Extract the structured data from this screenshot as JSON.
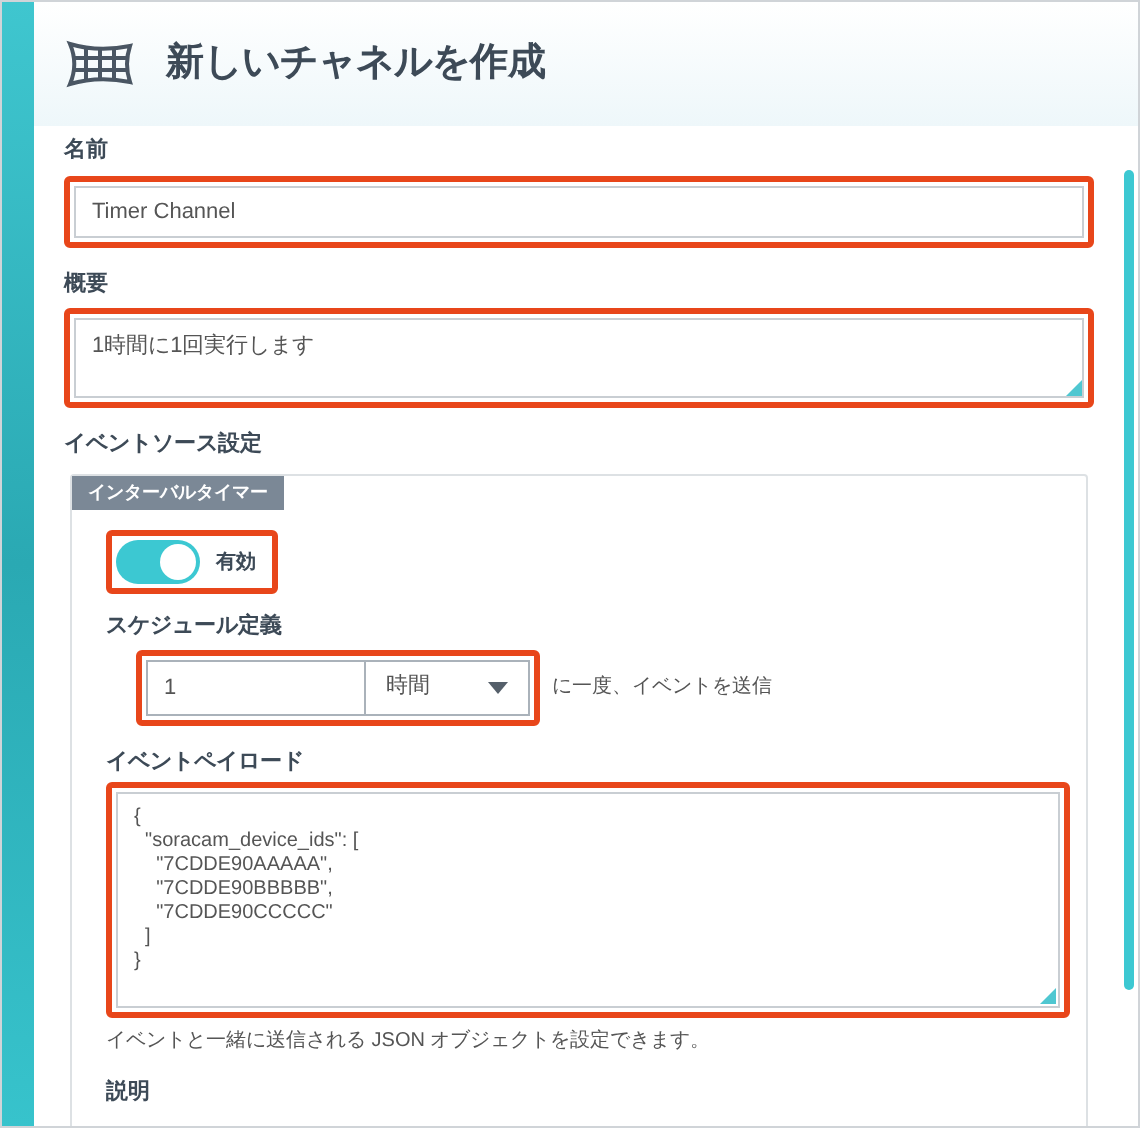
{
  "header": {
    "title": "新しいチャネルを作成"
  },
  "name_field": {
    "label": "名前",
    "value": "Timer Channel"
  },
  "summary_field": {
    "label": "概要",
    "value": "1時間に1回実行します"
  },
  "event_source": {
    "label": "イベントソース設定",
    "tab": "インターバルタイマー",
    "toggle": {
      "on": true,
      "label": "有効"
    },
    "schedule": {
      "label": "スケジュール定義",
      "value": "1",
      "unit": "時間",
      "suffix": "に一度、イベントを送信"
    },
    "payload": {
      "label": "イベントペイロード",
      "lines": [
        "{",
        "  \"soracam_device_ids\": [",
        "    \"7CDDE90AAAAA\",",
        "    \"7CDDE90BBBBB\",",
        "    \"7CDDE90CCCCC\"",
        "  ]",
        "}"
      ],
      "help": "イベントと一緒に送信される JSON オブジェクトを設定できます。"
    },
    "description_label": "説明"
  }
}
